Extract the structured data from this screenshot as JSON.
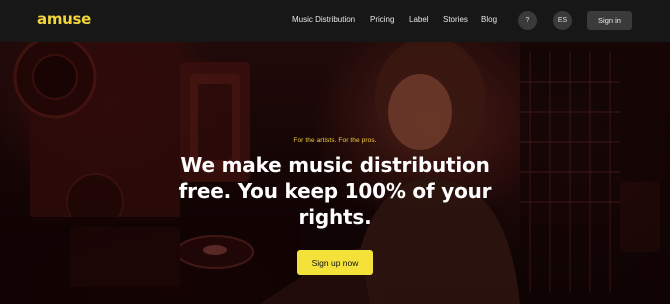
{
  "brand": {
    "logo_text": "amuse",
    "logo_color": "#f2d53c"
  },
  "nav": {
    "links": [
      {
        "label": "Music Distribution"
      },
      {
        "label": "Pricing"
      },
      {
        "label": "Label"
      },
      {
        "label": "Stories"
      },
      {
        "label": "Blog"
      }
    ],
    "help_label": "?",
    "language_label": "ES",
    "signin_label": "Sign in"
  },
  "hero": {
    "tagline": "For the artists. For the pros.",
    "headline_lines": [
      "We make music distribution",
      "free. You keep 100% of your",
      "rights."
    ],
    "cta_label": "Sign up now",
    "accent_color": "#f4e23a"
  }
}
